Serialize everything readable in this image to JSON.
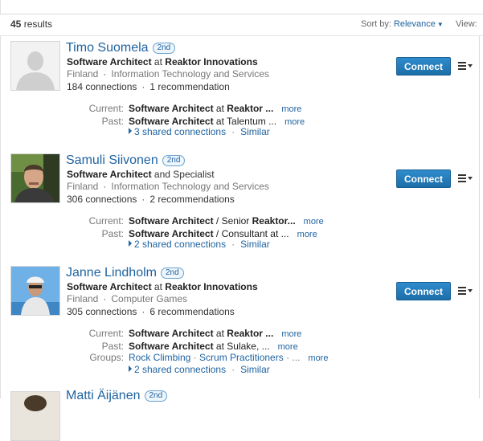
{
  "header": {
    "results_count": "45",
    "results_label": "results",
    "sort_label": "Sort by:",
    "sort_value": "Relevance",
    "view_label": "View:"
  },
  "results": [
    {
      "name": "Timo Suomela",
      "degree": "2nd",
      "headline_bold1": "Software Architect",
      "headline_mid": " at ",
      "headline_bold2": "Reaktor Innovations",
      "location": "Finland",
      "industry": "Information Technology and Services",
      "connections": "184 connections",
      "recommendations": "1 recommendation",
      "connect_label": "Connect",
      "current_label": "Current:",
      "current_bold": "Software Architect",
      "current_rest": " at ",
      "current_bold2": "Reaktor ...",
      "past_label": "Past:",
      "past_bold": "Software Architect",
      "past_rest": " at Talentum ...",
      "more_label": "more",
      "shared_connections": "3 shared connections",
      "similar_label": "Similar",
      "photo": "default-avatar"
    },
    {
      "name": "Samuli Siivonen",
      "degree": "2nd",
      "headline_bold1": "Software Architect",
      "headline_mid": " and Specialist",
      "headline_bold2": "",
      "location": "Finland",
      "industry": "Information Technology and Services",
      "connections": "306 connections",
      "recommendations": "2 recommendations",
      "connect_label": "Connect",
      "current_label": "Current:",
      "current_bold": "Software Architect",
      "current_rest": " / Senior ",
      "current_bold2": "Reaktor...",
      "past_label": "Past:",
      "past_bold": "Software Architect",
      "past_rest": " / Consultant at ...",
      "more_label": "more",
      "shared_connections": "2 shared connections",
      "similar_label": "Similar",
      "photo": "profile-photo"
    },
    {
      "name": "Janne Lindholm",
      "degree": "2nd",
      "headline_bold1": "Software Architect",
      "headline_mid": " at ",
      "headline_bold2": "Reaktor Innovations",
      "location": "Finland",
      "industry": "Computer Games",
      "connections": "305 connections",
      "recommendations": "6 recommendations",
      "connect_label": "Connect",
      "current_label": "Current:",
      "current_bold": "Software Architect",
      "current_rest": " at ",
      "current_bold2": "Reaktor ...",
      "past_label": "Past:",
      "past_bold": "Software Architect",
      "past_rest": " at Sulake, ...",
      "groups_label": "Groups:",
      "group1": "Rock Climbing",
      "group2": "Scrum Practitioners",
      "group_more": " · ...",
      "more_label": "more",
      "shared_connections": "2 shared connections",
      "similar_label": "Similar",
      "photo": "profile-photo"
    },
    {
      "name": "Matti Äijänen",
      "degree": "2nd",
      "photo": "profile-photo"
    }
  ]
}
